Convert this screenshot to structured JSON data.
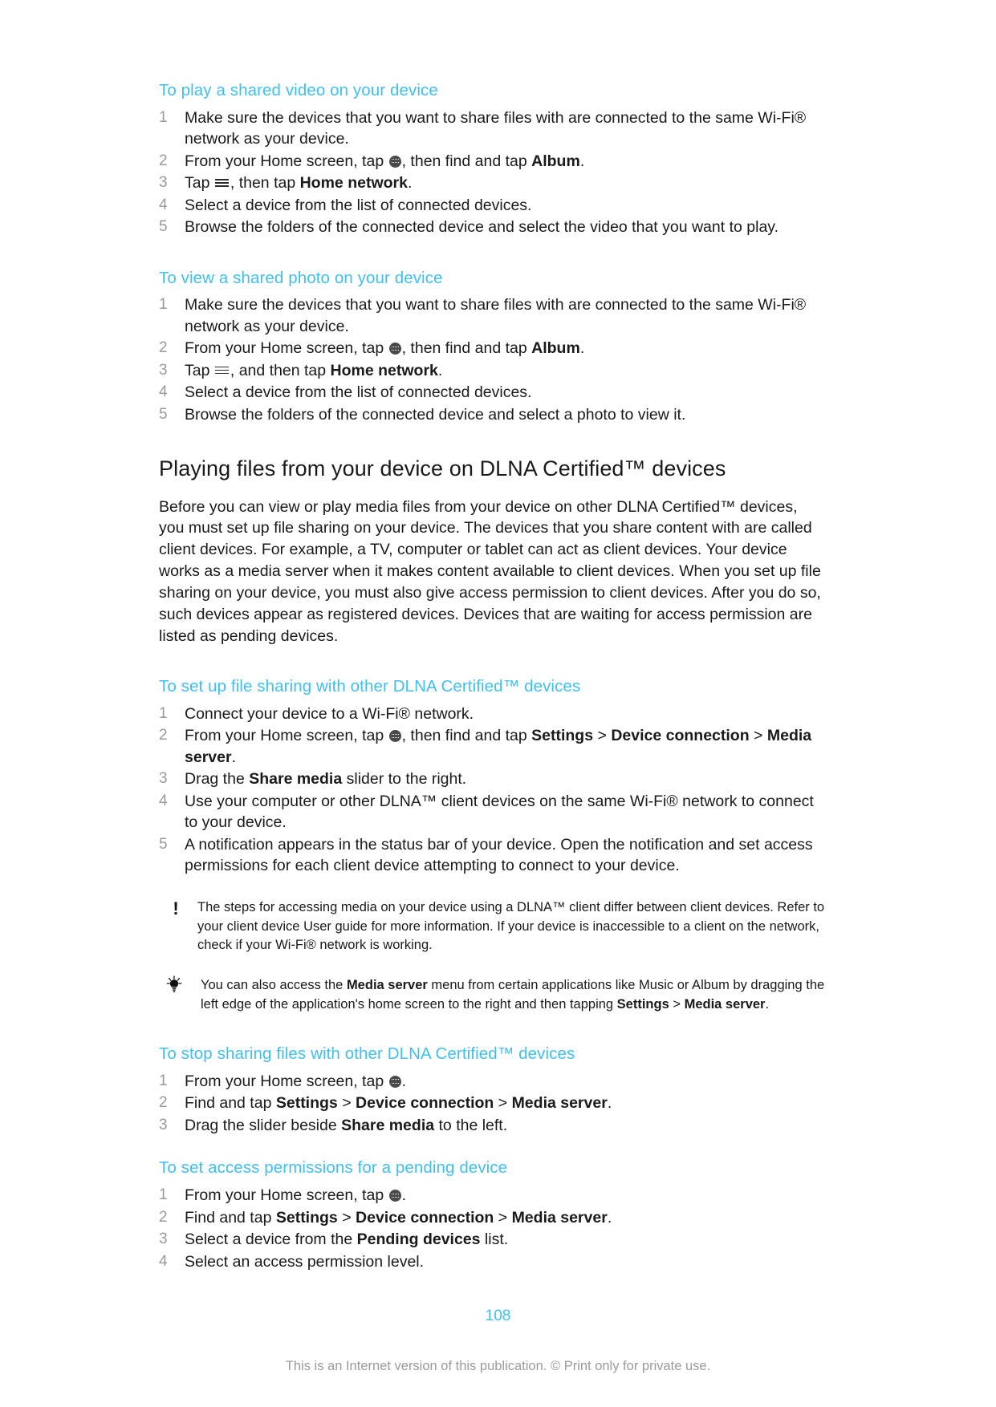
{
  "document": {
    "page_number": "108",
    "footer_text": "This is an Internet version of this publication. © Print only for private use.",
    "accent_color": "#3fc0ef",
    "body_color": "#1a1a1a",
    "step_number_color": "#9a9a9a"
  },
  "sections": {
    "play_shared_video": {
      "heading": "To play a shared video on your device",
      "steps": [
        {
          "parts": [
            {
              "type": "text",
              "value": "Make sure the devices that you want to share files with are connected to the same Wi-Fi® network as your device."
            }
          ],
          "plain": "Make sure the devices that you want to share files with are connected to the same Wi-Fi® network as your device."
        },
        {
          "before": "From your Home screen, tap ",
          "icon": "app-drawer-icon",
          "middle": ", then find and tap ",
          "bold": "Album",
          "after": "."
        },
        {
          "before": "Tap ",
          "icon": "hamburger-menu-icon",
          "middle": ", then tap ",
          "bold": "Home network",
          "after": "."
        },
        {
          "plain": "Select a device from the list of connected devices."
        },
        {
          "plain": "Browse the folders of the connected device and select the video that you want to play."
        }
      ]
    },
    "view_shared_photo": {
      "heading": "To view a shared photo on your device",
      "steps": [
        {
          "plain": "Make sure the devices that you want to share files with are connected to the same Wi-Fi® network as your device."
        },
        {
          "before": "From your Home screen, tap ",
          "icon": "app-drawer-icon",
          "middle": ", then find and tap ",
          "bold": "Album",
          "after": "."
        },
        {
          "before": "Tap ",
          "icon": "hamburger-menu-icon",
          "middle": ", and then tap ",
          "bold": "Home network",
          "after": "."
        },
        {
          "plain": "Select a device from the list of connected devices."
        },
        {
          "plain": "Browse the folders of the connected device and select a photo to view it."
        }
      ]
    },
    "playing_files": {
      "heading": "Playing files from your device on DLNA Certified™ devices",
      "body": "Before you can view or play media files from your device on other DLNA Certified™ devices, you must set up file sharing on your device. The devices that you share content with are called client devices. For example, a TV, computer or tablet can act as client devices. Your device works as a media server when it makes content available to client devices. When you set up file sharing on your device, you must also give access permission to client devices. After you do so, such devices appear as registered devices. Devices that are waiting for access permission are listed as pending devices."
    },
    "set_up_file_sharing": {
      "heading": "To set up file sharing with other DLNA Certified™ devices",
      "steps": [
        {
          "plain": "Connect your device to a Wi-Fi® network."
        },
        {
          "before": "From your Home screen, tap ",
          "icon": "app-drawer-icon",
          "middle": ", then find and tap ",
          "bold": "Settings",
          "sep1": " > ",
          "bold2": "Device connection",
          "sep2": " > ",
          "bold3": "Media server",
          "after": "."
        },
        {
          "before": "Drag the ",
          "bold": "Share media",
          "after": " slider to the right."
        },
        {
          "plain": "Use your computer or other DLNA™ client devices on the same Wi-Fi® network to connect to your device."
        },
        {
          "plain": "A notification appears in the status bar of your device. Open the notification and set access permissions for each client device attempting to connect to your device."
        }
      ],
      "note": {
        "icon": "exclamation-icon",
        "text": "The steps for accessing media on your device using a DLNA™ client differ between client devices. Refer to your client device User guide for more information. If your device is inaccessible to a client on the network, check if your Wi-Fi® network is working."
      },
      "tip": {
        "icon": "lightbulb-icon",
        "before": "You can also access the ",
        "bold": "Media server",
        "middle": " menu from certain applications like Music or Album by dragging the left edge of the application's home screen to the right and then tapping ",
        "bold2": "Settings",
        "sep": " > ",
        "bold3": "Media server",
        "after": "."
      }
    },
    "stop_sharing": {
      "heading": "To stop sharing files with other DLNA Certified™ devices",
      "steps": [
        {
          "before": "From your Home screen, tap ",
          "icon": "app-drawer-icon",
          "after": "."
        },
        {
          "before": "Find and tap ",
          "bold": "Settings",
          "sep1": " > ",
          "bold2": "Device connection",
          "sep2": " > ",
          "bold3": "Media server",
          "after": "."
        },
        {
          "before": "Drag the slider beside ",
          "bold": "Share media",
          "after": " to the left."
        }
      ]
    },
    "pending_device": {
      "heading": "To set access permissions for a pending device",
      "steps": [
        {
          "before": "From your Home screen, tap ",
          "icon": "app-drawer-icon",
          "after": "."
        },
        {
          "before": "Find and tap ",
          "bold": "Settings",
          "sep1": " > ",
          "bold2": "Device connection",
          "sep2": " > ",
          "bold3": "Media server",
          "after": "."
        },
        {
          "before": "Select a device from the ",
          "bold": "Pending devices",
          "after": " list."
        },
        {
          "plain": "Select an access permission level."
        }
      ]
    }
  }
}
